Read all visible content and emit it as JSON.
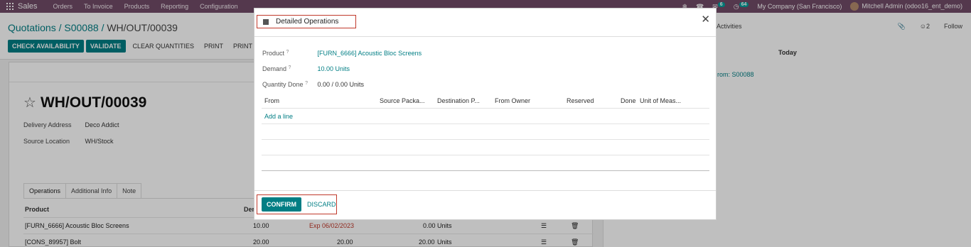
{
  "navbar": {
    "brand": "Sales",
    "menus": [
      "Orders",
      "To Invoice",
      "Products",
      "Reporting",
      "Configuration"
    ],
    "chat_count": "6",
    "activity_count": "64",
    "company": "My Company (San Francisco)",
    "user": "Mitchell Admin (odoo16_ent_demo)"
  },
  "control": {
    "breadcrumb": [
      "Quotations",
      "S00088",
      "WH/OUT/00039"
    ],
    "breadcrumb_sep": "/",
    "buttons": {
      "check_availability": "CHECK AVAILABILITY",
      "validate": "VALIDATE",
      "clear_quantities": "CLEAR QUANTITIES",
      "print": "PRINT",
      "print_labels": "PRINT LABELS"
    },
    "activities": "Activities",
    "followers_count": "2",
    "follow": "Follow"
  },
  "form": {
    "title": "WH/OUT/00039",
    "delivery_address_label": "Delivery Address",
    "delivery_address": "Deco Addict",
    "source_location_label": "Source Location",
    "source_location": "WH/Stock",
    "tabs": [
      "Operations",
      "Additional Info",
      "Note"
    ],
    "columns": {
      "product": "Product",
      "demand": "Dem"
    },
    "rows": [
      {
        "product": "[FURN_6666] Acoustic Bloc Screens",
        "demand": "10.00",
        "lot": "Exp 06/02/2023",
        "qty": "0.00",
        "uom": "Units"
      },
      {
        "product": "[CONS_89957] Bolt",
        "demand": "20.00",
        "lot": "20.00",
        "qty": "20.00",
        "uom": "Units"
      }
    ]
  },
  "chatter": {
    "today": "Today",
    "message": "rom: S00088"
  },
  "modal": {
    "title": "Detailed Operations",
    "product_label": "Product",
    "product": "[FURN_6666] Acoustic Bloc Screens",
    "demand_label": "Demand",
    "demand": "10.00 Units",
    "qty_done_label": "Quantity Done",
    "qty_done": "0.00 / 0.00 Units",
    "help_mark": "?",
    "columns": {
      "from": "From",
      "source_package": "Source Packa...",
      "destination_package": "Destination P...",
      "from_owner": "From Owner",
      "reserved": "Reserved",
      "done": "Done",
      "uom": "Unit of Meas..."
    },
    "add_line": "Add a line",
    "confirm": "CONFIRM",
    "discard": "DISCARD"
  }
}
